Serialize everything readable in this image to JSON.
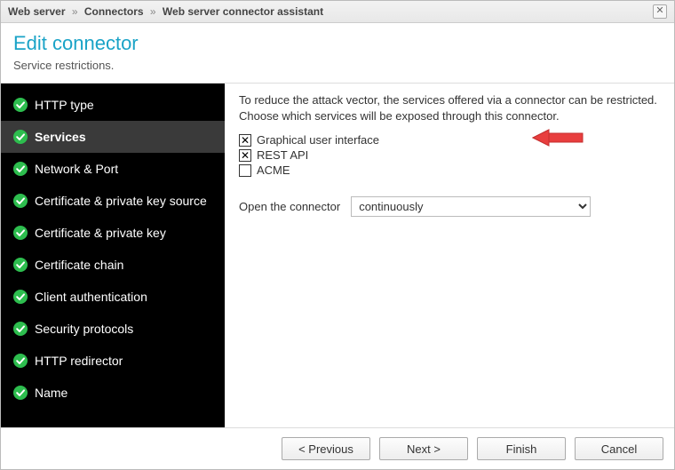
{
  "breadcrumb": {
    "part1": "Web server",
    "part2": "Connectors",
    "part3": "Web server connector assistant",
    "sep": "»"
  },
  "close_glyph": "✕",
  "header": {
    "title": "Edit connector",
    "subtitle": "Service restrictions."
  },
  "sidebar": {
    "items": [
      {
        "label": "HTTP type",
        "active": false
      },
      {
        "label": "Services",
        "active": true
      },
      {
        "label": "Network & Port",
        "active": false
      },
      {
        "label": "Certificate & private key source",
        "active": false
      },
      {
        "label": "Certificate & private key",
        "active": false
      },
      {
        "label": "Certificate chain",
        "active": false
      },
      {
        "label": "Client authentication",
        "active": false
      },
      {
        "label": "Security protocols",
        "active": false
      },
      {
        "label": "HTTP redirector",
        "active": false
      },
      {
        "label": "Name",
        "active": false
      }
    ]
  },
  "content": {
    "description": "To reduce the attack vector, the services offered via a connector can be restricted. Choose which services will be exposed through this connector.",
    "checkboxes": [
      {
        "label": "Graphical user interface",
        "checked": true
      },
      {
        "label": "REST API",
        "checked": true
      },
      {
        "label": "ACME",
        "checked": false
      }
    ],
    "open_label": "Open the connector",
    "open_select": {
      "selected": "continuously",
      "options": [
        "continuously"
      ]
    }
  },
  "checkbox_glyph": "✕",
  "footer": {
    "previous": "< Previous",
    "next": "Next >",
    "finish": "Finish",
    "cancel": "Cancel"
  }
}
